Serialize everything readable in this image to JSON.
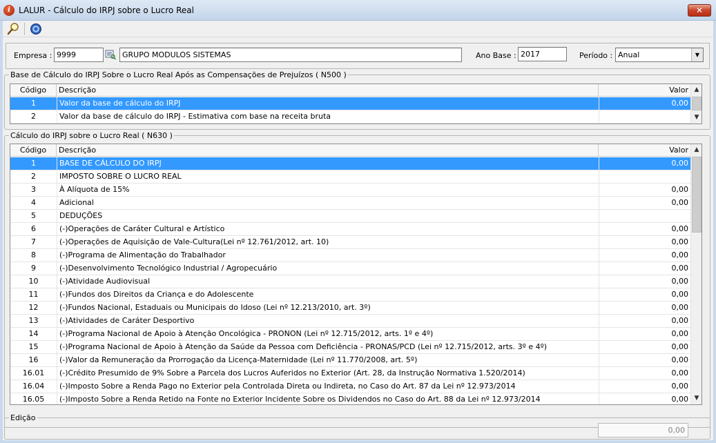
{
  "window": {
    "title": "LALUR - Cálculo do IRPJ sobre o Lucro Real",
    "app_icon_glyph": "i",
    "close_glyph": "✕"
  },
  "toolbar": {
    "search_icon": "search-icon",
    "info_icon": "info-icon"
  },
  "header": {
    "empresa_label": "Empresa :",
    "empresa_code": "9999",
    "empresa_name": "GRUPO MODULOS SISTEMAS",
    "ano_base_label": "Ano Base :",
    "ano_base_value": "2017",
    "periodo_label": "Período :",
    "periodo_value": "Anual"
  },
  "n500": {
    "legend": "Base de Cálculo do IRPJ Sobre o Lucro Real Após as Compensações de Prejuízos  ( N500 )",
    "columns": {
      "code": "Código",
      "desc": "Descrição",
      "value": "Valor"
    },
    "rows": [
      {
        "code": "1",
        "desc": "Valor da base de cálculo do IRPJ",
        "value": "0,00",
        "selected": true
      },
      {
        "code": "2",
        "desc": "Valor da base de cálculo do IRPJ - Estimativa com base na receita bruta",
        "value": "",
        "selected": false
      }
    ]
  },
  "n630": {
    "legend": "Cálculo do IRPJ sobre o Lucro Real ( N630 )",
    "columns": {
      "code": "Código",
      "desc": "Descrição",
      "value": "Valor"
    },
    "rows": [
      {
        "code": "1",
        "desc": "BASE DE CÁLCULO DO IRPJ",
        "value": "0,00",
        "selected": true
      },
      {
        "code": "2",
        "desc": "IMPOSTO SOBRE O LUCRO REAL",
        "value": "",
        "selected": false
      },
      {
        "code": "3",
        "desc": "À Alíquota de 15%",
        "value": "0,00",
        "selected": false
      },
      {
        "code": "4",
        "desc": "Adicional",
        "value": "0,00",
        "selected": false
      },
      {
        "code": "5",
        "desc": "DEDUÇÕES",
        "value": "",
        "selected": false
      },
      {
        "code": "6",
        "desc": "(-)Operações de Caráter Cultural e Artístico",
        "value": "0,00",
        "selected": false
      },
      {
        "code": "7",
        "desc": "(-)Operações de Aquisição de Vale-Cultura(Lei nº 12.761/2012, art. 10)",
        "value": "0,00",
        "selected": false
      },
      {
        "code": "8",
        "desc": "(-)Programa de Alimentação do Trabalhador",
        "value": "0,00",
        "selected": false
      },
      {
        "code": "9",
        "desc": "(-)Desenvolvimento Tecnológico Industrial / Agropecuário",
        "value": "0,00",
        "selected": false
      },
      {
        "code": "10",
        "desc": "(-)Atividade Audiovisual",
        "value": "0,00",
        "selected": false
      },
      {
        "code": "11",
        "desc": "(-)Fundos dos Direitos da Criança e do Adolescente",
        "value": "0,00",
        "selected": false
      },
      {
        "code": "12",
        "desc": "(-)Fundos Nacional, Estaduais ou Municipais do Idoso (Lei nº 12.213/2010, art. 3º)",
        "value": "0,00",
        "selected": false
      },
      {
        "code": "13",
        "desc": "(-)Atividades de Caráter Desportivo",
        "value": "0,00",
        "selected": false
      },
      {
        "code": "14",
        "desc": "(-)Programa Nacional de Apoio à Atenção Oncológica - PRONON (Lei nº 12.715/2012, arts. 1º e 4º)",
        "value": "0,00",
        "selected": false
      },
      {
        "code": "15",
        "desc": "(-)Programa Nacional de Apoio à Atenção da Saúde da Pessoa com Deficiência - PRONAS/PCD (Lei nº 12.715/2012, arts. 3º e 4º)",
        "value": "0,00",
        "selected": false
      },
      {
        "code": "16",
        "desc": "(-)Valor da Remuneração da Prorrogação da Licença-Maternidade (Lei nº 11.770/2008, art. 5º)",
        "value": "0,00",
        "selected": false
      },
      {
        "code": "16.01",
        "desc": "(-)Crédito Presumido de 9% Sobre a Parcela dos Lucros Auferidos no Exterior (Art. 28, da Instrução Normativa 1.520/2014)",
        "value": "0,00",
        "selected": false
      },
      {
        "code": "16.04",
        "desc": "(-)Imposto Sobre a Renda Pago no Exterior pela Controlada Direta ou Indireta, no Caso do Art. 87 da Lei nº 12.973/2014",
        "value": "0,00",
        "selected": false
      },
      {
        "code": "16.05",
        "desc": "(-)Imposto Sobre a Renda Retido na Fonte no Exterior Incidente Sobre os Dividendos no Caso do Art. 88 da Lei nº 12.973/2014",
        "value": "0,00",
        "selected": false
      }
    ]
  },
  "edicao": {
    "legend": "Edição",
    "value": "0,00"
  },
  "colors": {
    "selection": "#3399ff",
    "window_bg": "#f0f0f0",
    "frame": "#c9d9ec"
  }
}
